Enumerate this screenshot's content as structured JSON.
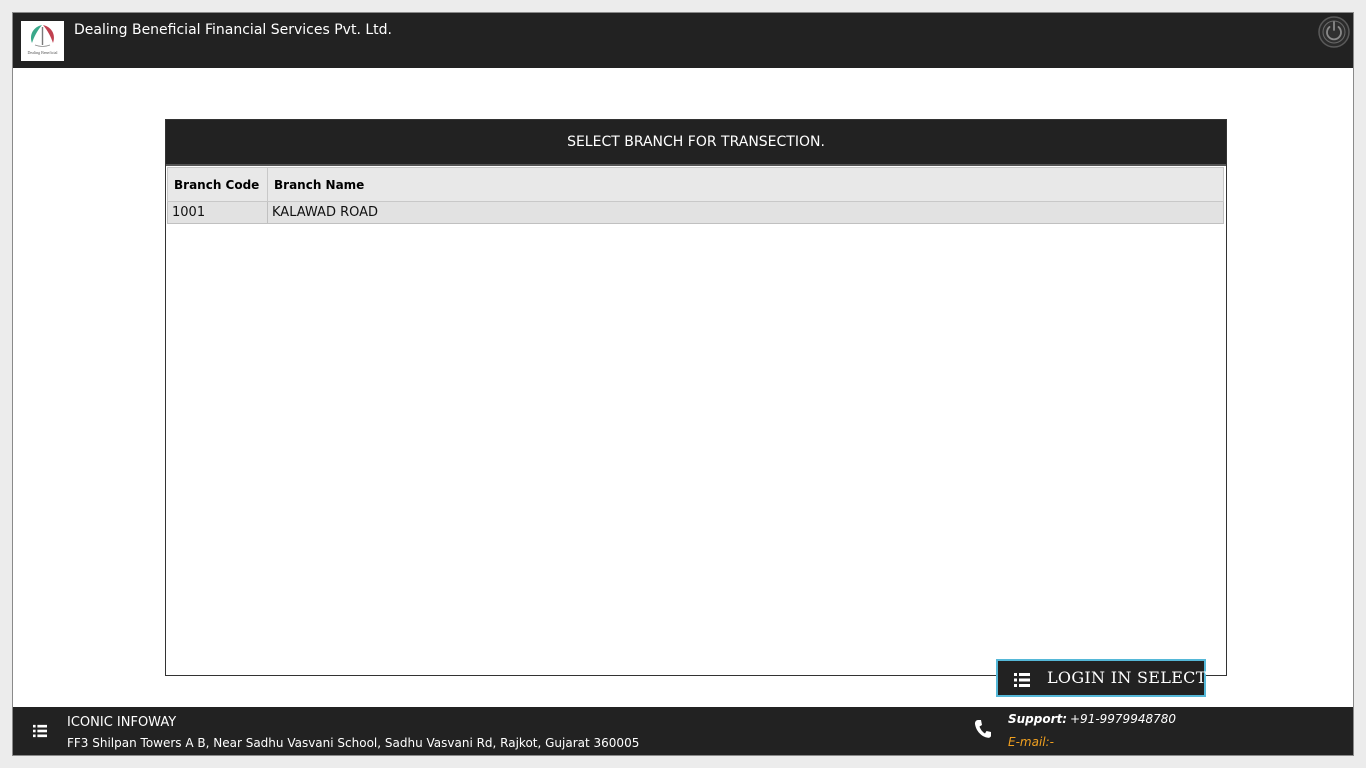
{
  "header": {
    "company_name": "Dealing Beneficial Financial Services Pvt. Ltd.",
    "logo_text": "Dealing Beneficial",
    "power_icon": "power-icon"
  },
  "panel": {
    "title": "SELECT BRANCH FOR TRANSECTION.",
    "columns": {
      "code": "Branch Code",
      "name": "Branch Name"
    },
    "rows": [
      {
        "code": "1001",
        "name": "KALAWAD ROAD"
      }
    ]
  },
  "action": {
    "login_label": "LOGIN IN SELECT",
    "icon": "list-icon"
  },
  "footer": {
    "firm": "ICONIC INFOWAY",
    "address": "FF3 Shilpan Towers A  B, Near Sadhu Vasvani School, Sadhu Vasvani Rd, Rajkot, Gujarat 360005",
    "support_label": "Support:",
    "support_phone": "+91-9979948780",
    "email_label": "E-mail:-"
  },
  "colors": {
    "bar": "#222222",
    "accent_border": "#55b8d8",
    "email_label": "#f0a020"
  }
}
